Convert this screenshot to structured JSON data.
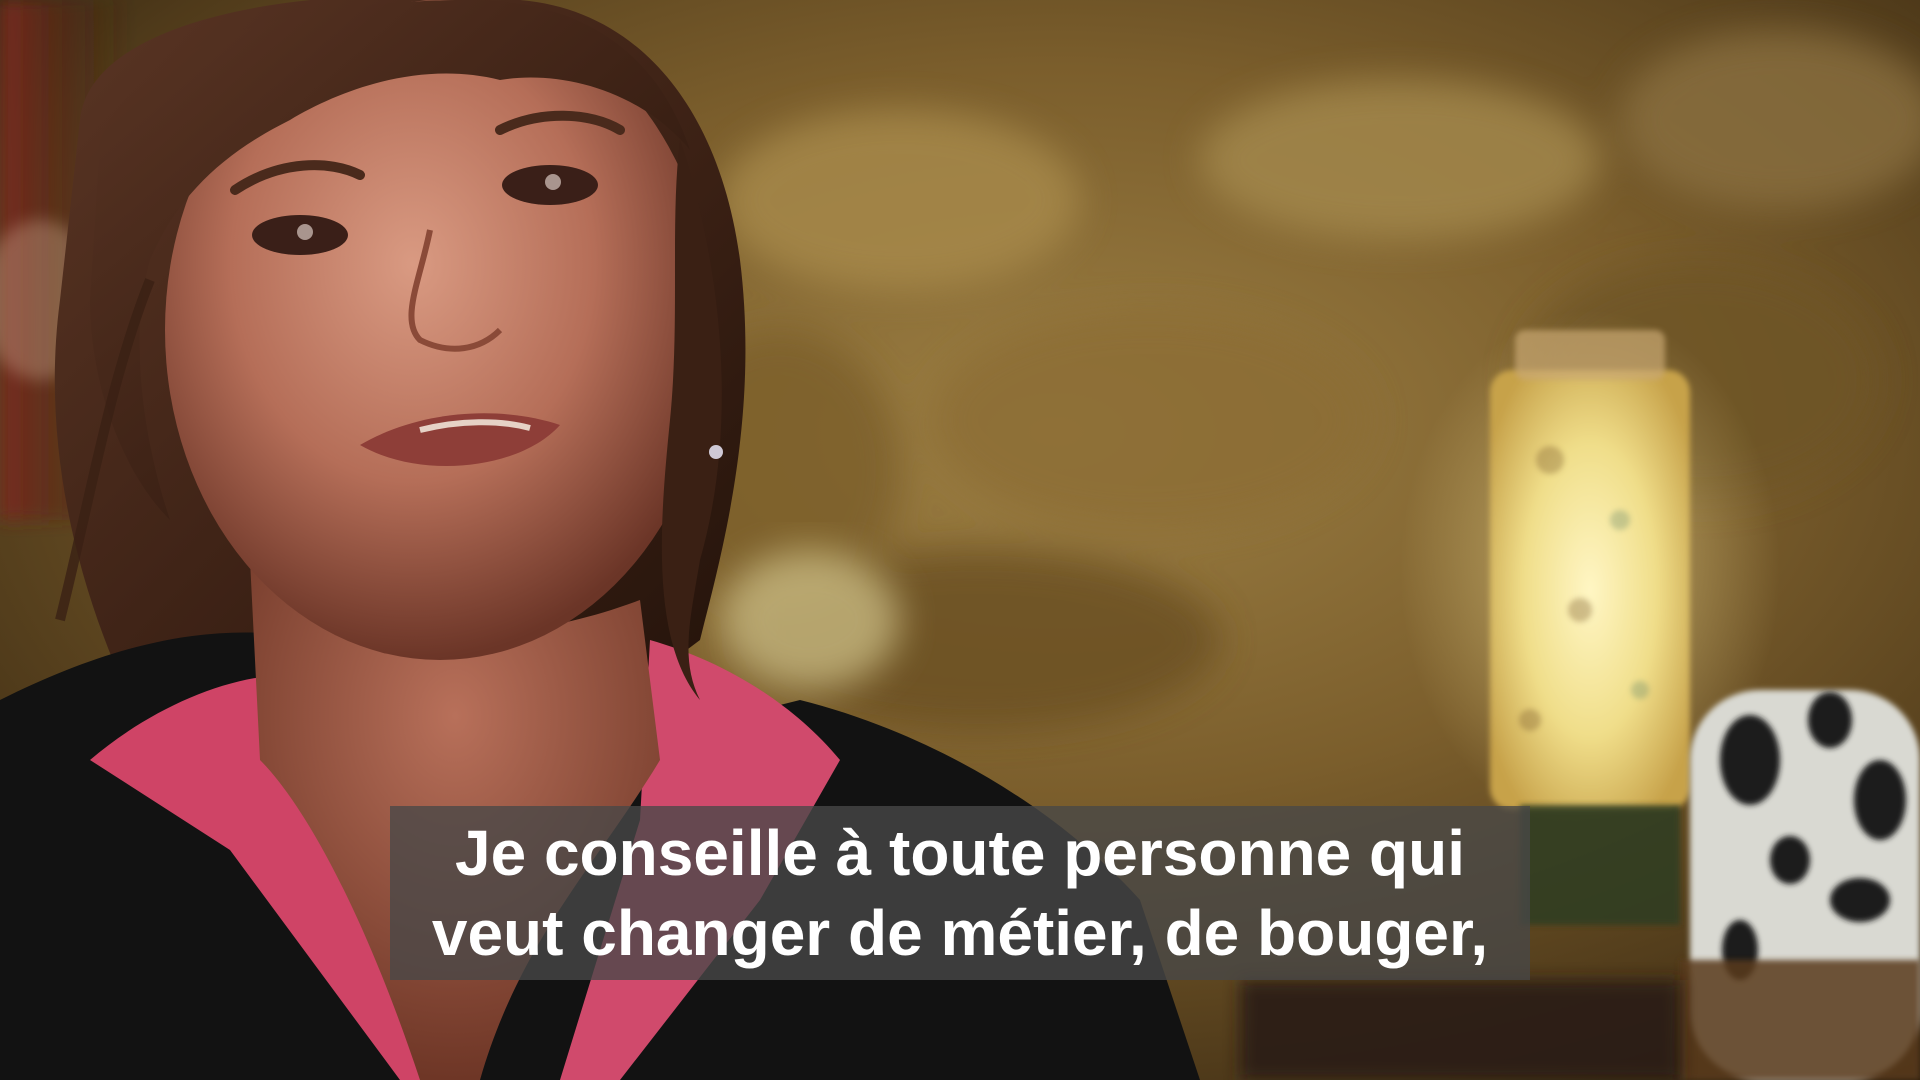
{
  "video": {
    "subtitle": {
      "line1": "Je conseille à toute personne qui",
      "line2": "veut changer de métier, de bouger,"
    }
  },
  "colors": {
    "subtitle_text": "#ffffff",
    "subtitle_background": "#484848",
    "background_wall": "#8a6a32",
    "lamp_glow": "#f4e7a0",
    "shirt": "#d7456a",
    "jacket": "#141414"
  }
}
